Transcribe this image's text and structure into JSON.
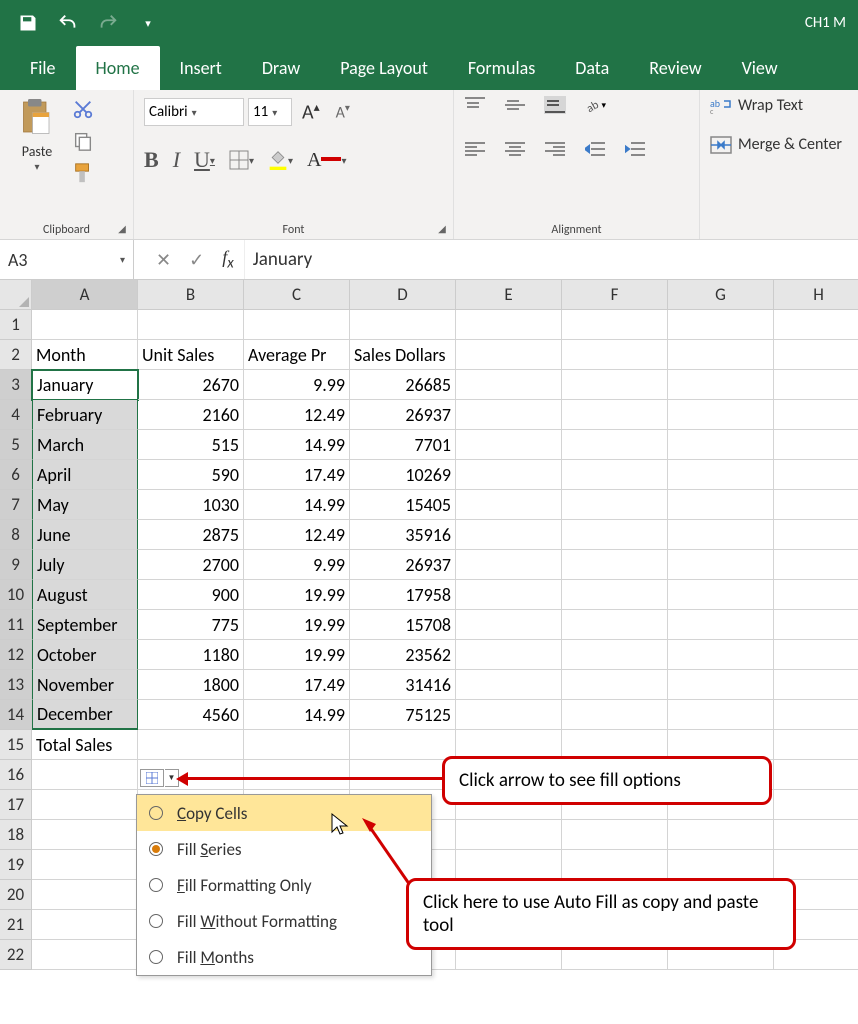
{
  "titlebar": {
    "title": "CH1 M"
  },
  "tabs": [
    "File",
    "Home",
    "Insert",
    "Draw",
    "Page Layout",
    "Formulas",
    "Data",
    "Review",
    "View"
  ],
  "active_tab": "Home",
  "clipboard": {
    "paste": "Paste",
    "group": "Clipboard"
  },
  "font": {
    "name": "Calibri",
    "size": "11",
    "group": "Font"
  },
  "alignment": {
    "wrap": "Wrap Text",
    "merge": "Merge & Center",
    "group": "Alignment"
  },
  "namebox": "A3",
  "formula": "January",
  "cols": [
    "A",
    "B",
    "C",
    "D",
    "E",
    "F",
    "G",
    "H"
  ],
  "headers": [
    "Month",
    "Unit Sales",
    "Average Pr",
    "Sales Dollars"
  ],
  "data": [
    {
      "m": "January",
      "u": "2670",
      "a": "9.99",
      "s": "26685"
    },
    {
      "m": "February",
      "u": "2160",
      "a": "12.49",
      "s": "26937"
    },
    {
      "m": "March",
      "u": "515",
      "a": "14.99",
      "s": "7701"
    },
    {
      "m": "April",
      "u": "590",
      "a": "17.49",
      "s": "10269"
    },
    {
      "m": "May",
      "u": "1030",
      "a": "14.99",
      "s": "15405"
    },
    {
      "m": "June",
      "u": "2875",
      "a": "12.49",
      "s": "35916"
    },
    {
      "m": "July",
      "u": "2700",
      "a": "9.99",
      "s": "26937"
    },
    {
      "m": "August",
      "u": "900",
      "a": "19.99",
      "s": "17958"
    },
    {
      "m": "September",
      "u": "775",
      "a": "19.99",
      "s": "15708"
    },
    {
      "m": "October",
      "u": "1180",
      "a": "19.99",
      "s": "23562"
    },
    {
      "m": "November",
      "u": "1800",
      "a": "17.49",
      "s": "31416"
    },
    {
      "m": "December",
      "u": "4560",
      "a": "14.99",
      "s": "75125"
    }
  ],
  "totals_label": "Total Sales",
  "autofill": {
    "options": [
      "Copy Cells",
      "Fill Series",
      "Fill Formatting Only",
      "Fill Without Formatting",
      "Fill Months"
    ],
    "underlines": [
      "C",
      "S",
      "F",
      "W",
      "M"
    ],
    "selected": 1,
    "hover": 0
  },
  "callout1": "Click arrow to see fill options",
  "callout2": "Click here to use Auto Fill as copy and paste tool"
}
